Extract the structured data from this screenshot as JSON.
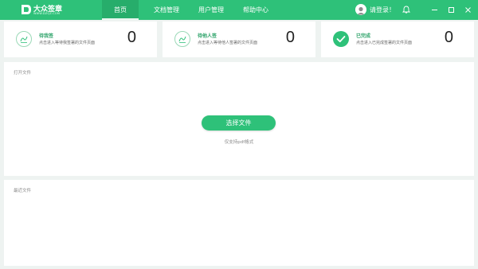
{
  "app": {
    "title": "大众签章",
    "subtitle": "WWW.DZQZ.COM"
  },
  "nav": {
    "tabs": [
      {
        "label": "首页",
        "active": true
      },
      {
        "label": "文档管理",
        "active": false
      },
      {
        "label": "用户管理",
        "active": false
      },
      {
        "label": "帮助中心",
        "active": false
      }
    ]
  },
  "user": {
    "login_text": "请登录！",
    "avatar_icon": "user-avatar"
  },
  "window_controls": [
    "bell-icon",
    "minimize-icon",
    "maximize-icon",
    "close-icon"
  ],
  "cards": [
    {
      "title": "待我签",
      "desc": "点击进入等待我签署的文件页面",
      "count": "0",
      "icon": "signature-pending-icon"
    },
    {
      "title": "待他人签",
      "desc": "点击进入等待他人签署的文件页面",
      "count": "0",
      "icon": "signature-others-icon"
    },
    {
      "title": "已完成",
      "desc": "点击进入已完成签署的文件页面",
      "count": "0",
      "icon": "check-icon"
    }
  ],
  "open_panel": {
    "title": "打开文件",
    "button_label": "选择文件",
    "note": "仅支持pdf格式"
  },
  "recent_panel": {
    "title": "最近文件"
  },
  "colors": {
    "brand": "#2ec179",
    "brand_dark": "#27ad6b",
    "background": "#eef3f1"
  }
}
